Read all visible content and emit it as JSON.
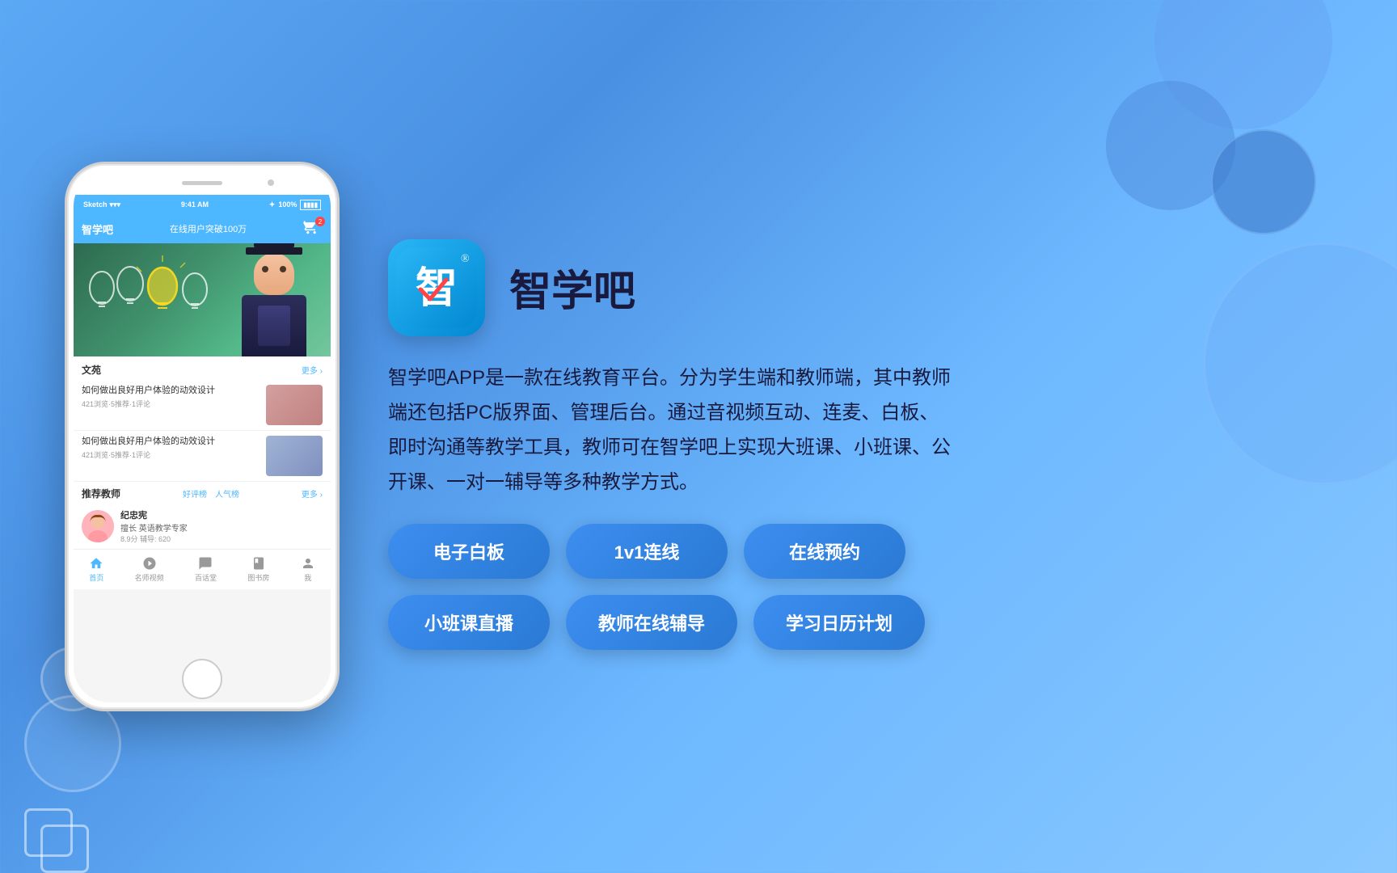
{
  "background": {
    "gradient_start": "#5ba8f5",
    "gradient_end": "#89c8ff"
  },
  "phone": {
    "status_bar": {
      "carrier": "Sketch",
      "wifi": "wifi",
      "time": "9:41 AM",
      "bluetooth": "bluetooth",
      "battery": "100%"
    },
    "header": {
      "logo": "智学吧",
      "promo": "在线用户突破100万",
      "cart_count": "2"
    },
    "sections": {
      "articles_title": "文苑",
      "articles_more": "更多 ›",
      "article1_title": "如何做出良好用户体验的动效设计",
      "article1_meta": "421浏览·5推荐·1评论",
      "article2_title": "如何做出良好用户体验的动效设计",
      "article2_meta": "421浏览·5推荐·1评论",
      "teachers_title": "推荐教师",
      "teachers_more": "更多 ›",
      "tab_good": "好评榜",
      "tab_popular": "人气榜",
      "teacher_name": "纪忠宪",
      "teacher_specialty": "擅长 英语教学专家",
      "teacher_stats": "8.9分  辅导: 620"
    },
    "nav": {
      "home": "首页",
      "celebrity": "名师视频",
      "classroom": "百话堂",
      "library": "图书房",
      "profile": "我"
    }
  },
  "brand": {
    "logo_char": "智",
    "registered_mark": "®",
    "name": "智学吧",
    "description": "智学吧APP是一款在线教育平台。分为学生端和教师端，其中教师端还包括PC版界面、管理后台。通过音视频互动、连麦、白板、即时沟通等教学工具，教师可在智学吧上实现大班课、小班课、公开课、一对一辅导等多种教学方式。"
  },
  "features": {
    "row1": {
      "btn1": "电子白板",
      "btn2": "1v1连线",
      "btn3": "在线预约"
    },
    "row2": {
      "btn1": "小班课直播",
      "btn2": "教师在线辅导",
      "btn3": "学习日历计划"
    }
  }
}
